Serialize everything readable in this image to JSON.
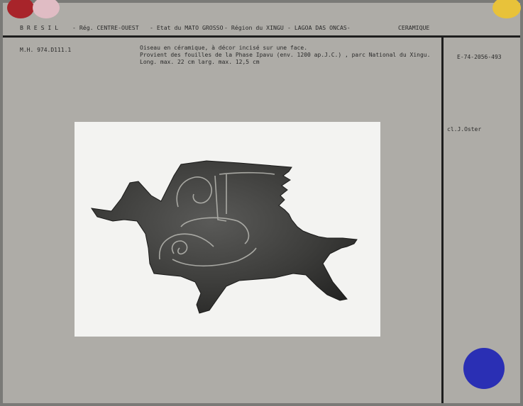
{
  "header": {
    "country": "B R E S I L",
    "region": "- Rég. CENTRE-OUEST",
    "state": "- Etat du MATO GROSSO",
    "subregion": "- Région du XINGU",
    "site": "- LAGOA DAS ONCAS-",
    "category": "CERAMIQUE"
  },
  "record": {
    "inventory_number": "M.H. 974.D111.1",
    "description_lines": [
      "Oiseau en céramique, à décor incisé sur une face.",
      "Provient des fouilles de la Phase Ipavu (env. 1200 ap.J.C.) , parc National du Xingu.",
      "Long. max. 22 cm  larg. max. 12,5 cm"
    ],
    "photo_number": "E-74-2056-493",
    "photographer": "cl.J.Oster"
  },
  "colors": {
    "card": "#aeaca7",
    "dot_red": "#a8242a",
    "dot_pink": "#e0bcc4",
    "dot_yellow": "#e8c23a",
    "dot_blue": "#2a2fb4"
  }
}
